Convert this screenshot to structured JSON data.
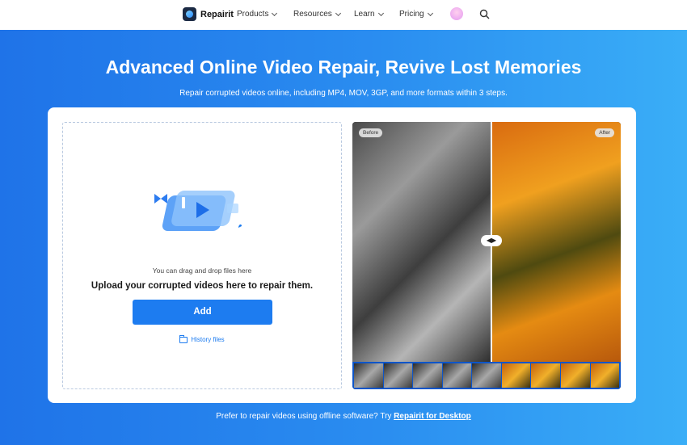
{
  "nav": {
    "brand": "Repairit",
    "menu": [
      {
        "label": "Products"
      },
      {
        "label": "Resources"
      },
      {
        "label": "Learn"
      },
      {
        "label": "Pricing"
      }
    ]
  },
  "hero": {
    "title": "Advanced Online Video Repair, Revive Lost Memories",
    "subtitle": "Repair corrupted videos online, including MP4, MOV, 3GP, and more formats within 3 steps."
  },
  "upload": {
    "drag_hint": "You can drag and drop files here",
    "heading": "Upload your corrupted videos here to repair them.",
    "add_label": "Add",
    "history_label": "History files"
  },
  "preview": {
    "before_label": "Before",
    "after_label": "After"
  },
  "footer": {
    "prefix": "Prefer to repair videos using offline software? Try ",
    "link": "Repairit for Desktop"
  },
  "colors": {
    "accent": "#1d7cf0",
    "hero_start": "#1f73e8",
    "hero_end": "#3aaef7"
  }
}
